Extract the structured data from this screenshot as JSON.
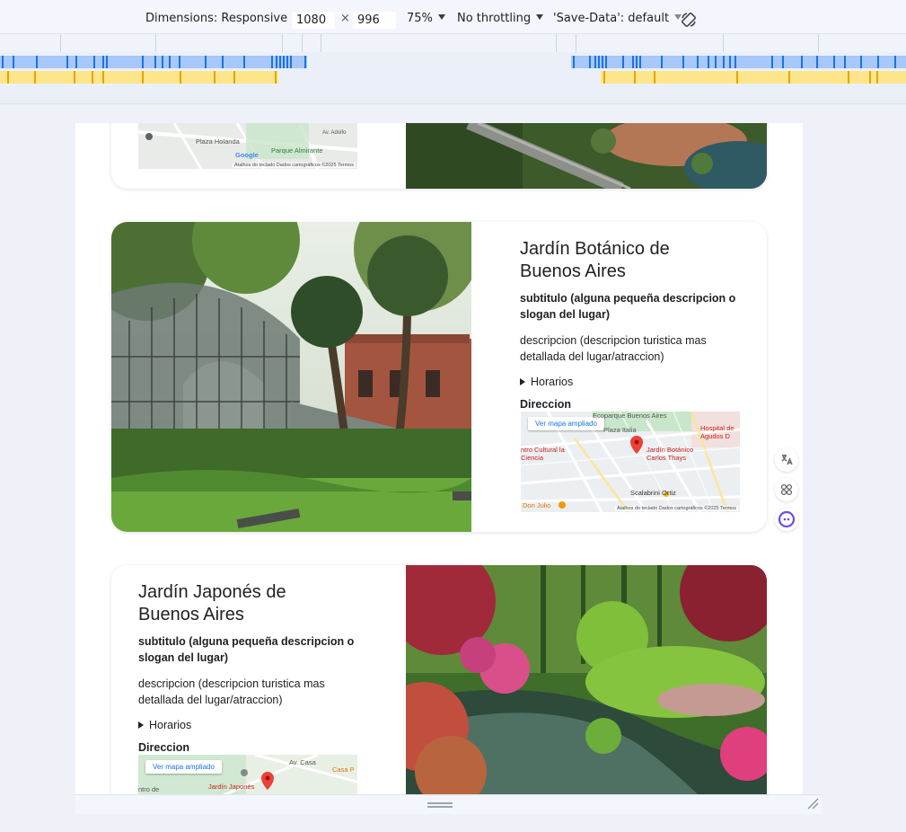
{
  "toolbar": {
    "dimensions_label": "Dimensions: Responsive",
    "width_value": "1080",
    "times": "×",
    "height_value": "996",
    "zoom_label": "75%",
    "throttle_label": "No throttling",
    "save_data_label": "'Save-Data': default",
    "rotate_icon": "rotate-icon"
  },
  "cards": [
    {
      "map": {
        "labels": [
          "Plaza Holanda",
          "Parque Almirante",
          "Av. Adolfo"
        ],
        "footer": "Atalhos do teclado   Dados cartográficos ©2025   Termos",
        "logo": "Google"
      }
    },
    {
      "title": "Jardín Botánico de Buenos Aires",
      "subtitle": "subtitulo (alguna pequeña descripcion o slogan del lugar)",
      "description": "descripcion (descripcion turistica mas detallada del lugar/atraccion)",
      "hours_label": "Horarios",
      "address_label": "Direccion",
      "map": {
        "button": "Ver mapa ampliado",
        "labels": [
          "Ecoparque Buenos Aires",
          "Plaza Italia",
          "Hospital de Agudos D",
          "ntro Cultural la Ciencia",
          "Jardín Botánico Carlos Thays",
          "Scalabrini Ortiz",
          "Don Julio"
        ],
        "footer": "Atalhos do teclado   Dados cartográficos ©2025   Termos"
      }
    },
    {
      "title": "Jardín Japonés de Buenos Aires",
      "subtitle": "subtitulo (alguna pequeña descripcion o slogan del lugar)",
      "description": "descripcion (descripcion turistica mas detallada del lugar/atraccion)",
      "hours_label": "Horarios",
      "address_label": "Direccion",
      "map": {
        "button": "Ver mapa ampliado",
        "labels": [
          "Av. Casa",
          "Casa P",
          "Jardín Japonés",
          "ntro de"
        ]
      }
    }
  ],
  "side_icons": [
    "translate-icon",
    "apps-icon",
    "assistant-icon"
  ],
  "colors": {
    "accent": "#1a73e8",
    "map_pin": "#ea4335",
    "mq_blue": "#a8c7fa",
    "mq_blue_dark": "#1a73e8",
    "mq_yellow": "#fde68a",
    "mq_yellow_dark": "#e8a300"
  }
}
